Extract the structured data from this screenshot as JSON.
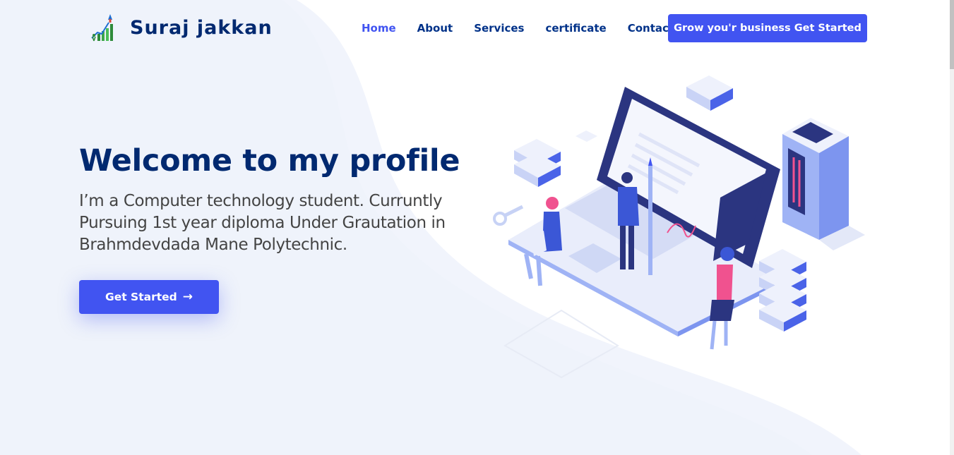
{
  "brand": {
    "name": "Suraj jakkan",
    "logo_icon": "rising-chart-rocket-icon"
  },
  "nav": {
    "items": [
      {
        "label": "Home",
        "active": true
      },
      {
        "label": "About",
        "active": false
      },
      {
        "label": "Services",
        "active": false
      },
      {
        "label": "certificate",
        "active": false
      },
      {
        "label": "Contact",
        "active": false
      }
    ],
    "cta_label": "Grow you'r business Get Started"
  },
  "hero": {
    "title": "Welcome to my profile",
    "description": "I’m a Computer technology student. Curruntly Pursuing 1st year diploma Under Grautation in Brahmdevdada Mane Polytechnic.",
    "button_label": "Get Started",
    "button_icon": "arrow-right-icon",
    "illustration": "isometric-laptop-team-illustration"
  },
  "colors": {
    "accent": "#4154f1",
    "heading": "#012970",
    "nav_text": "#013289",
    "body_text": "#444444",
    "background_wave": "#f0f3fb"
  }
}
